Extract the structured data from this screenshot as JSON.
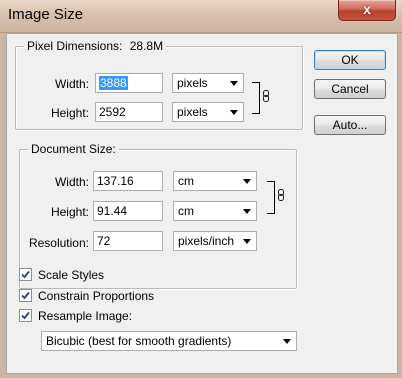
{
  "window": {
    "title": "Image Size",
    "close_glyph": "x"
  },
  "pixel_dimensions": {
    "legend": "Pixel Dimensions:",
    "size": "28.8M",
    "width_label": "Width:",
    "width_value": "3888",
    "width_unit": "pixels",
    "height_label": "Height:",
    "height_value": "2592",
    "height_unit": "pixels"
  },
  "document_size": {
    "legend": "Document Size:",
    "width_label": "Width:",
    "width_value": "137.16",
    "width_unit": "cm",
    "height_label": "Height:",
    "height_value": "91.44",
    "height_unit": "cm",
    "resolution_label": "Resolution:",
    "resolution_value": "72",
    "resolution_unit": "pixels/inch"
  },
  "options": {
    "scale_styles": {
      "label": "Scale Styles",
      "checked": true
    },
    "constrain_proportions": {
      "label": "Constrain Proportions",
      "checked": true
    },
    "resample_image": {
      "label": "Resample Image:",
      "checked": true
    },
    "resample_method": "Bicubic (best for smooth gradients)"
  },
  "buttons": {
    "ok": "OK",
    "cancel": "Cancel",
    "auto": "Auto..."
  },
  "colors": {
    "selection": "#3399ff",
    "dialog_bg": "#f0f0f0",
    "close": "#c8523e"
  },
  "icons": {
    "link": "chain-link-icon",
    "dropdown": "chevron-down-icon",
    "check": "checkmark-icon"
  }
}
